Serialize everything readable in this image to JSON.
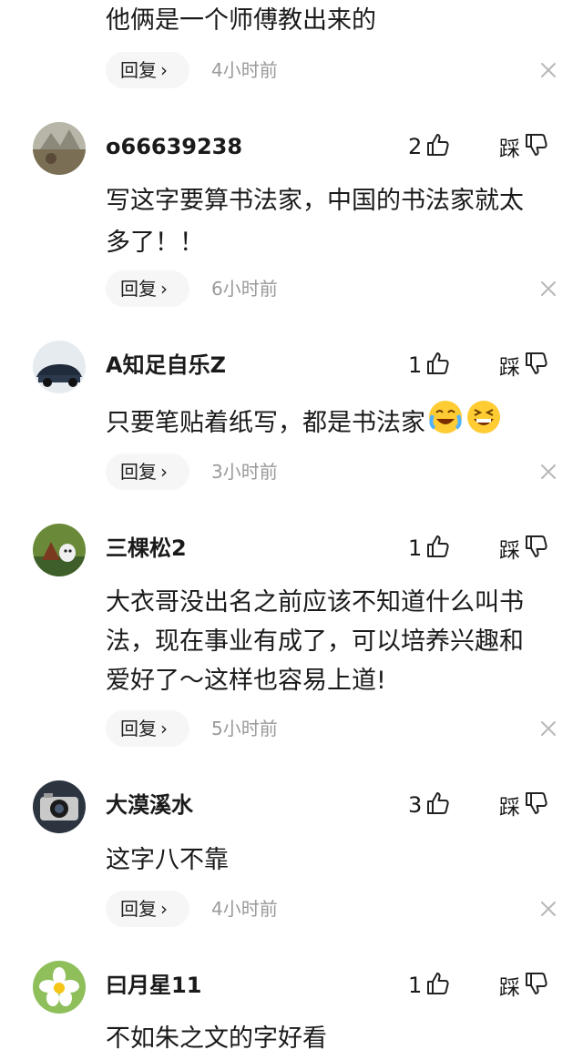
{
  "comments": [
    {
      "text": "他俩是一个师傅教出来的",
      "reply_label": "回复",
      "time": "4小时前"
    },
    {
      "username": "o66639238",
      "likes": "2",
      "dislike_label": "踩",
      "text_line1": "写这字要算书法家，中国的书法家就太",
      "text_line2": "多了！！",
      "reply_label": "回复",
      "time": "6小时前"
    },
    {
      "username": "A知足自乐Z",
      "likes": "1",
      "dislike_label": "踩",
      "text": "只要笔贴着纸写，都是书法家",
      "emojis": [
        "laughing-crying-emoji",
        "grinning-squint-emoji"
      ],
      "reply_label": "回复",
      "time": "3小时前"
    },
    {
      "username": "三棵松2",
      "likes": "1",
      "dislike_label": "踩",
      "text_line1": "大衣哥没出名之前应该不知道什么叫书",
      "text_line2": "法，现在事业有成了，可以培养兴趣和",
      "text_line3": "爱好了～这样也容易上道!",
      "reply_label": "回复",
      "time": "5小时前"
    },
    {
      "username": "大漠溪水",
      "likes": "3",
      "dislike_label": "踩",
      "text": "这字八不靠",
      "reply_label": "回复",
      "time": "4小时前"
    },
    {
      "username": "曰月星11",
      "likes": "1",
      "dislike_label": "踩",
      "text": "不如朱之文的字好看"
    }
  ],
  "icons": {
    "like": "thumb-up-icon",
    "dislike": "thumb-down-icon",
    "close": "close-icon",
    "chevron": "chevron-right-icon"
  }
}
